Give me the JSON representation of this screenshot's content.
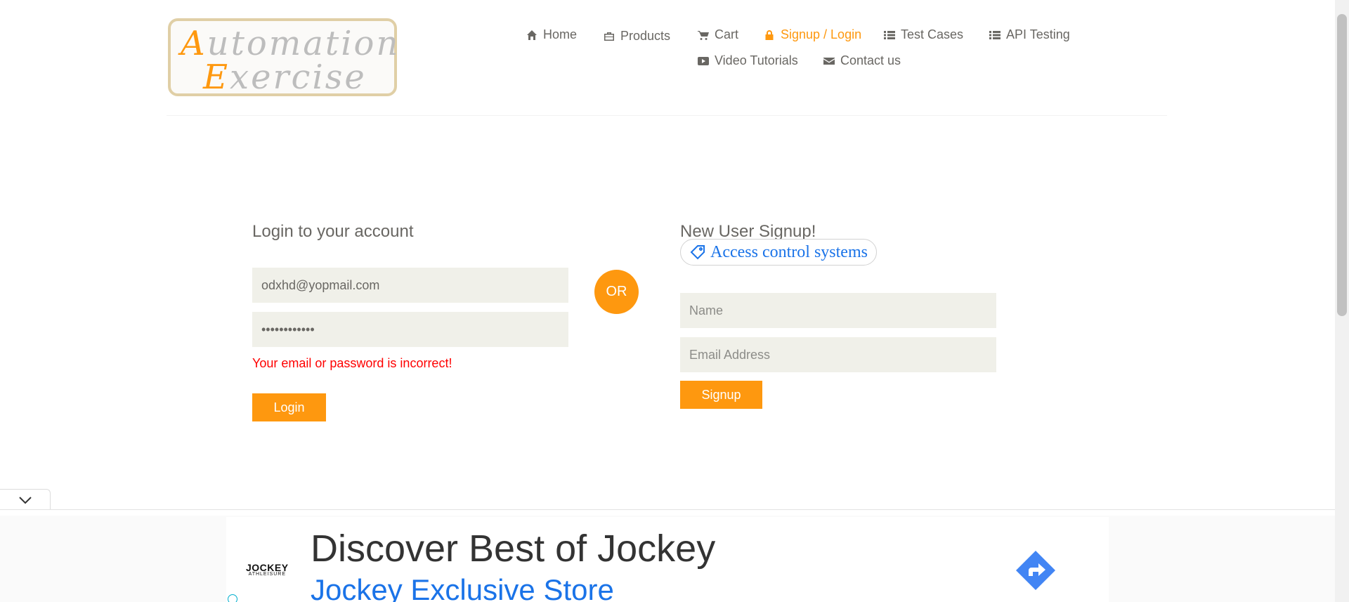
{
  "logo": {
    "line1_cap": "A",
    "line1_rest": "utomation",
    "line2_cap": "E",
    "line2_rest": "xercise"
  },
  "nav": {
    "items": [
      {
        "label": "Home",
        "icon": "home-icon"
      },
      {
        "label": "Products",
        "icon": "briefcase-icon"
      },
      {
        "label": "Cart",
        "icon": "cart-icon"
      },
      {
        "label": "Signup / Login",
        "icon": "lock-icon",
        "active": true
      },
      {
        "label": "Test Cases",
        "icon": "list-icon"
      },
      {
        "label": "API Testing",
        "icon": "list-icon"
      },
      {
        "label": "Video Tutorials",
        "icon": "youtube-play-icon"
      },
      {
        "label": "Contact us",
        "icon": "envelope-icon"
      }
    ]
  },
  "login": {
    "title": "Login to your account",
    "email_value": "odxhd@yopmail.com",
    "password_value": "••••••••••••",
    "error": "Your email or password is incorrect!",
    "button": "Login"
  },
  "or_label": "OR",
  "signup": {
    "title": "New User Signup!",
    "ad_chip": "Access control systems",
    "name_placeholder": "Name",
    "email_placeholder": "Email Address",
    "button": "Signup"
  },
  "ad": {
    "brand": "JOCKEY",
    "brand_sub": "ATHLEISURE",
    "headline": "Discover Best of Jockey",
    "subline": "Jockey Exclusive Store"
  },
  "colors": {
    "accent": "#fe980f",
    "error": "#ff0000",
    "field_bg": "#f0f0e9",
    "ad_link": "#1a73e8"
  }
}
